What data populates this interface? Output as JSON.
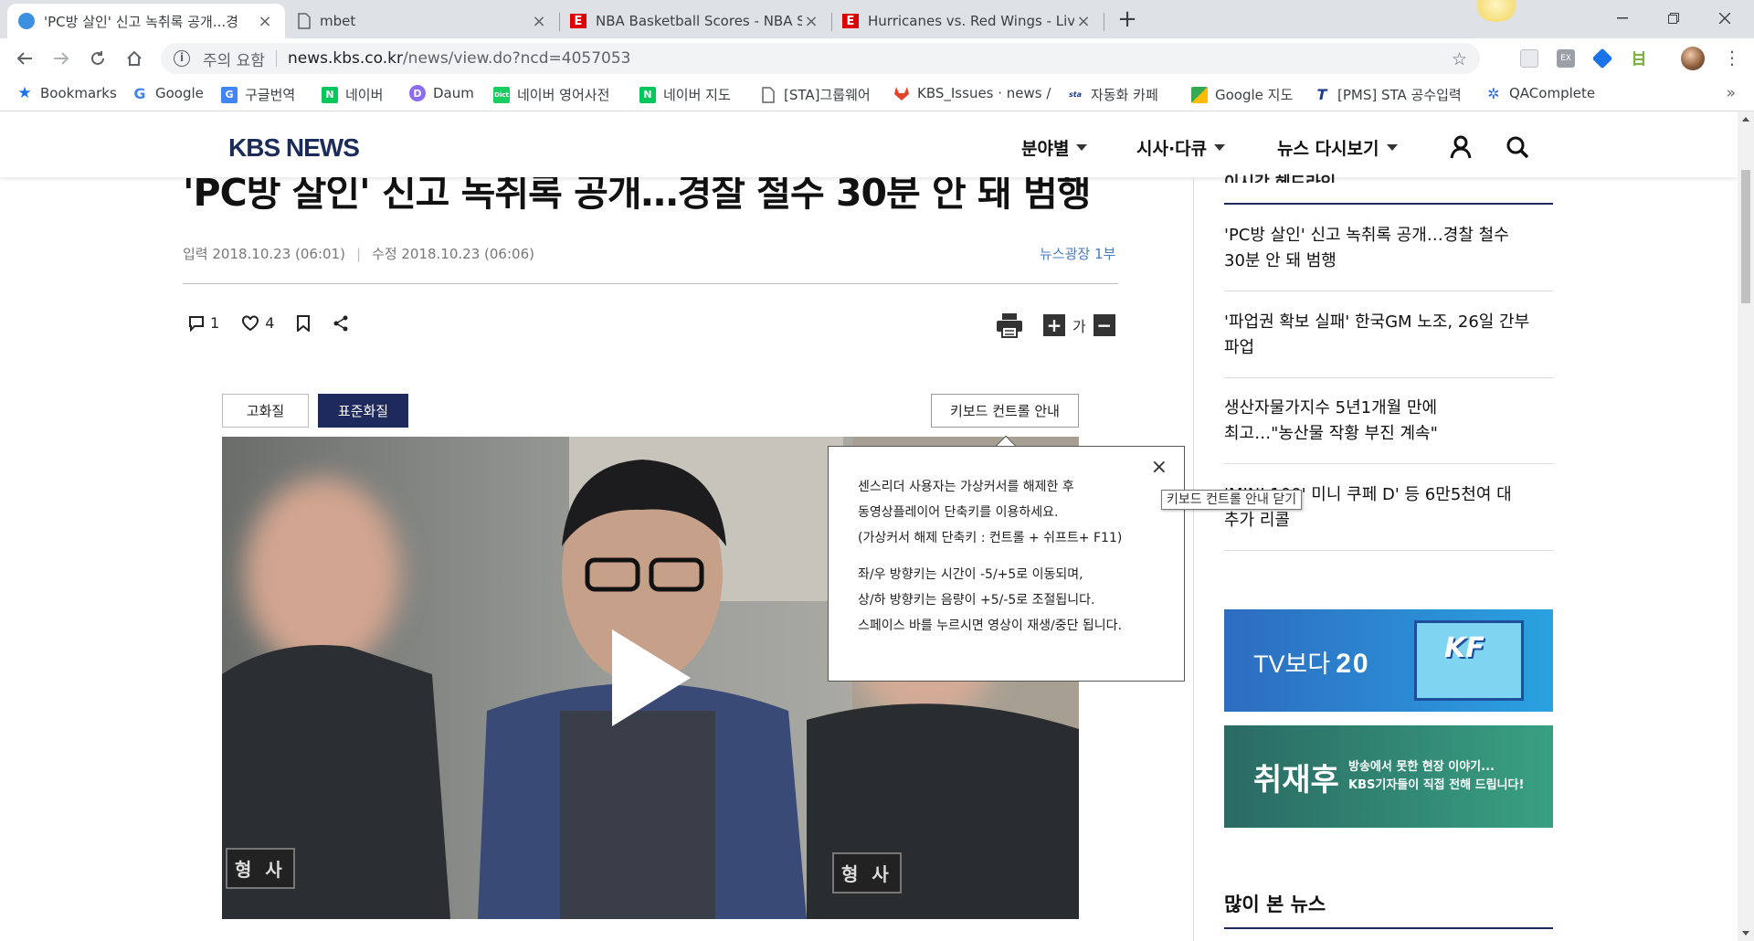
{
  "browser": {
    "tabs": [
      {
        "title": "'PC방 살인' 신고 녹취록 공개...경",
        "active": true,
        "icon": "kbs-favicon"
      },
      {
        "title": "mbet",
        "active": false,
        "icon": "page-icon"
      },
      {
        "title": "NBA Basketball Scores - NBA Sc",
        "active": false,
        "icon": "espn-icon"
      },
      {
        "title": "Hurricanes vs. Red Wings - Live",
        "active": false,
        "icon": "espn-icon"
      }
    ],
    "new_tab_label": "+",
    "address": {
      "security_label": "주의 요함",
      "host": "news.kbs.co.kr",
      "path": "/news/view.do?ncd=4057053"
    },
    "bookmarks": [
      {
        "label": "Bookmarks",
        "icon": "star-icon",
        "color": "#1a73e8"
      },
      {
        "label": "Google",
        "icon": "google-icon",
        "color": "#4285f4"
      },
      {
        "label": "구글번역",
        "icon": "translate-icon",
        "color": "#4285f4"
      },
      {
        "label": "네이버",
        "icon": "naver-icon",
        "color": "#03c75a"
      },
      {
        "label": "Daum",
        "icon": "daum-icon",
        "color": "#8c6df0"
      },
      {
        "label": "네이버 영어사전",
        "icon": "naver-dict-icon",
        "color": "#19ce60"
      },
      {
        "label": "네이버 지도",
        "icon": "naver-map-icon",
        "color": "#03c75a"
      },
      {
        "label": "[STA]그룹웨어",
        "icon": "page-icon",
        "color": "#5f6368"
      },
      {
        "label": "KBS_Issues · news / ",
        "icon": "gitlab-icon",
        "color": "#e24329"
      },
      {
        "label": "자동화 카페",
        "icon": "cafe-icon",
        "color": "#1e3c8c"
      },
      {
        "label": "Google 지도",
        "icon": "maps-icon",
        "color": "#34a853"
      },
      {
        "label": "[PMS] STA 공수입력",
        "icon": "pms-icon",
        "color": "#1e3c8c"
      },
      {
        "label": "QAComplete",
        "icon": "qacomplete-icon",
        "color": "#2f6fd8"
      }
    ],
    "bookmarks_more": "»"
  },
  "site": {
    "logo": "KBS NEWS",
    "menus": [
      {
        "label": "분야별"
      },
      {
        "label": "시사·다큐"
      },
      {
        "label": "뉴스 다시보기"
      }
    ]
  },
  "article": {
    "headline": "'PC방 살인' 신고 녹취록 공개…경찰 철수 30분 안 돼 범행",
    "input_label": "입력 2018.10.23 (06:01)",
    "modified_label": "수정 2018.10.23 (06:06)",
    "meta_sep": "|",
    "program": "뉴스광장 1부",
    "comment_count": "1",
    "like_count": "4",
    "font_label": "가",
    "font_plus": "+",
    "font_minus": "−"
  },
  "player": {
    "hq_label": "고화질",
    "sq_label": "표준화질",
    "keyboard_guide_label": "키보드 컨트롤 안내",
    "popup_lines": [
      "센스리더 사용자는 가상커서를 해제한 후",
      "동영상플레이어 단축키를 이용하세요.",
      "(가상커서 해제 단축키 : 컨트롤 + 쉬프트+ F11)",
      "좌/우 방향키는 시간이 -5/+5로 이동되며,",
      "상/하 방향키는 음량이 +5/-5로 조절됩니다.",
      "스페이스 바를 누르시면 영상이 재생/중단 됩니다."
    ],
    "popup_close": "×",
    "tooltip": "키보드 컨트롤 안내 닫기",
    "badge_text": "형 사"
  },
  "sidebar": {
    "top_title": "이시각 헤드라인",
    "items": [
      {
        "lines": [
          "'PC방 살인' 신고 녹취록 공개…경찰 철수",
          "30분 안 돼 범행"
        ]
      },
      {
        "lines": [
          "'파업권 확보 실패' 한국GM 노조, 26일 간부",
          "파업"
        ]
      },
      {
        "lines": [
          "생산자물가지수 5년1개월 만에",
          "최고…\"농산물 작황 부진 계속\""
        ]
      },
      {
        "lines": [
          "'MINI 100' 미니 쿠페 D' 등 6만5천여 대",
          "추가 리콜"
        ]
      }
    ],
    "banner1": {
      "text": "TV보다",
      "brand": "20",
      "kf": "KF"
    },
    "banner2": {
      "title": "취재후",
      "line1": "방송에서 못한 현장 이야기...",
      "line2": "KBS기자들이 직접 전해 드립니다!"
    },
    "popular_title": "많이 본 뉴스"
  },
  "colors": {
    "accent_navy": "#1e2a5c",
    "tab_strip": "#dee1e6",
    "program_link": "#4a7bc0"
  }
}
